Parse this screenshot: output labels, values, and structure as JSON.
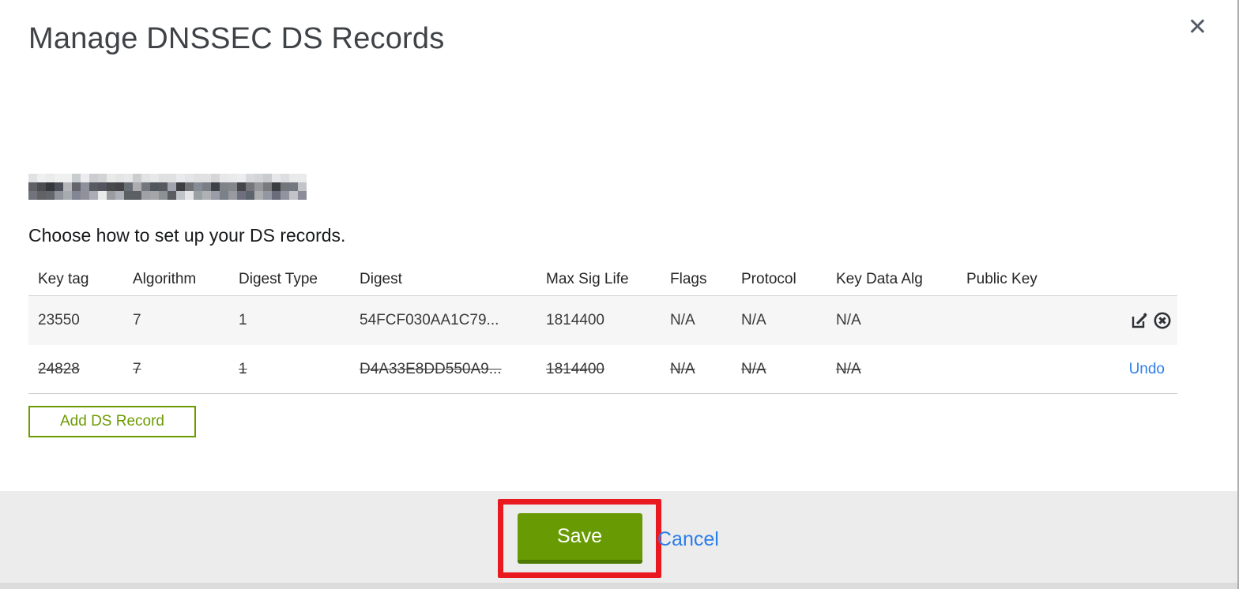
{
  "modal": {
    "title": "Manage DNSSEC DS Records",
    "close_glyph": "✕",
    "instruction": "Choose how to set up your DS records.",
    "domain_redacted": "pixelated-anonymized-domain"
  },
  "table": {
    "columns": [
      "Key tag",
      "Algorithm",
      "Digest Type",
      "Digest",
      "Max Sig Life",
      "Flags",
      "Protocol",
      "Key Data Alg",
      "Public Key",
      ""
    ],
    "rows": [
      {
        "key_tag": "23550",
        "algorithm": "7",
        "digest_type": "1",
        "digest": "54FCF030AA1C79...",
        "max_sig_life": "1814400",
        "flags": "N/A",
        "protocol": "N/A",
        "key_data_alg": "N/A",
        "public_key": "",
        "state": "current",
        "actions": [
          "edit-icon",
          "delete-icon"
        ]
      },
      {
        "key_tag": "24828",
        "algorithm": "7",
        "digest_type": "1",
        "digest": "D4A33E8DD550A9...",
        "max_sig_life": "1814400",
        "flags": "N/A",
        "protocol": "N/A",
        "key_data_alg": "N/A",
        "public_key": "",
        "state": "deleted",
        "action_label": "Undo"
      }
    ]
  },
  "buttons": {
    "add_ds_record": "Add DS Record",
    "save": "Save",
    "cancel": "Cancel"
  },
  "icons": {
    "close": "x-mark",
    "edit": "pencil-in-square",
    "delete": "x-in-circle"
  },
  "colors": {
    "accent_green": "#6b9b00",
    "save_button_green": "#689b03",
    "link_blue": "#2d7ee9",
    "annotation_red": "#e8191f",
    "footer_gray": "#ececec",
    "row_stripe_gray": "#f6f6f6"
  }
}
